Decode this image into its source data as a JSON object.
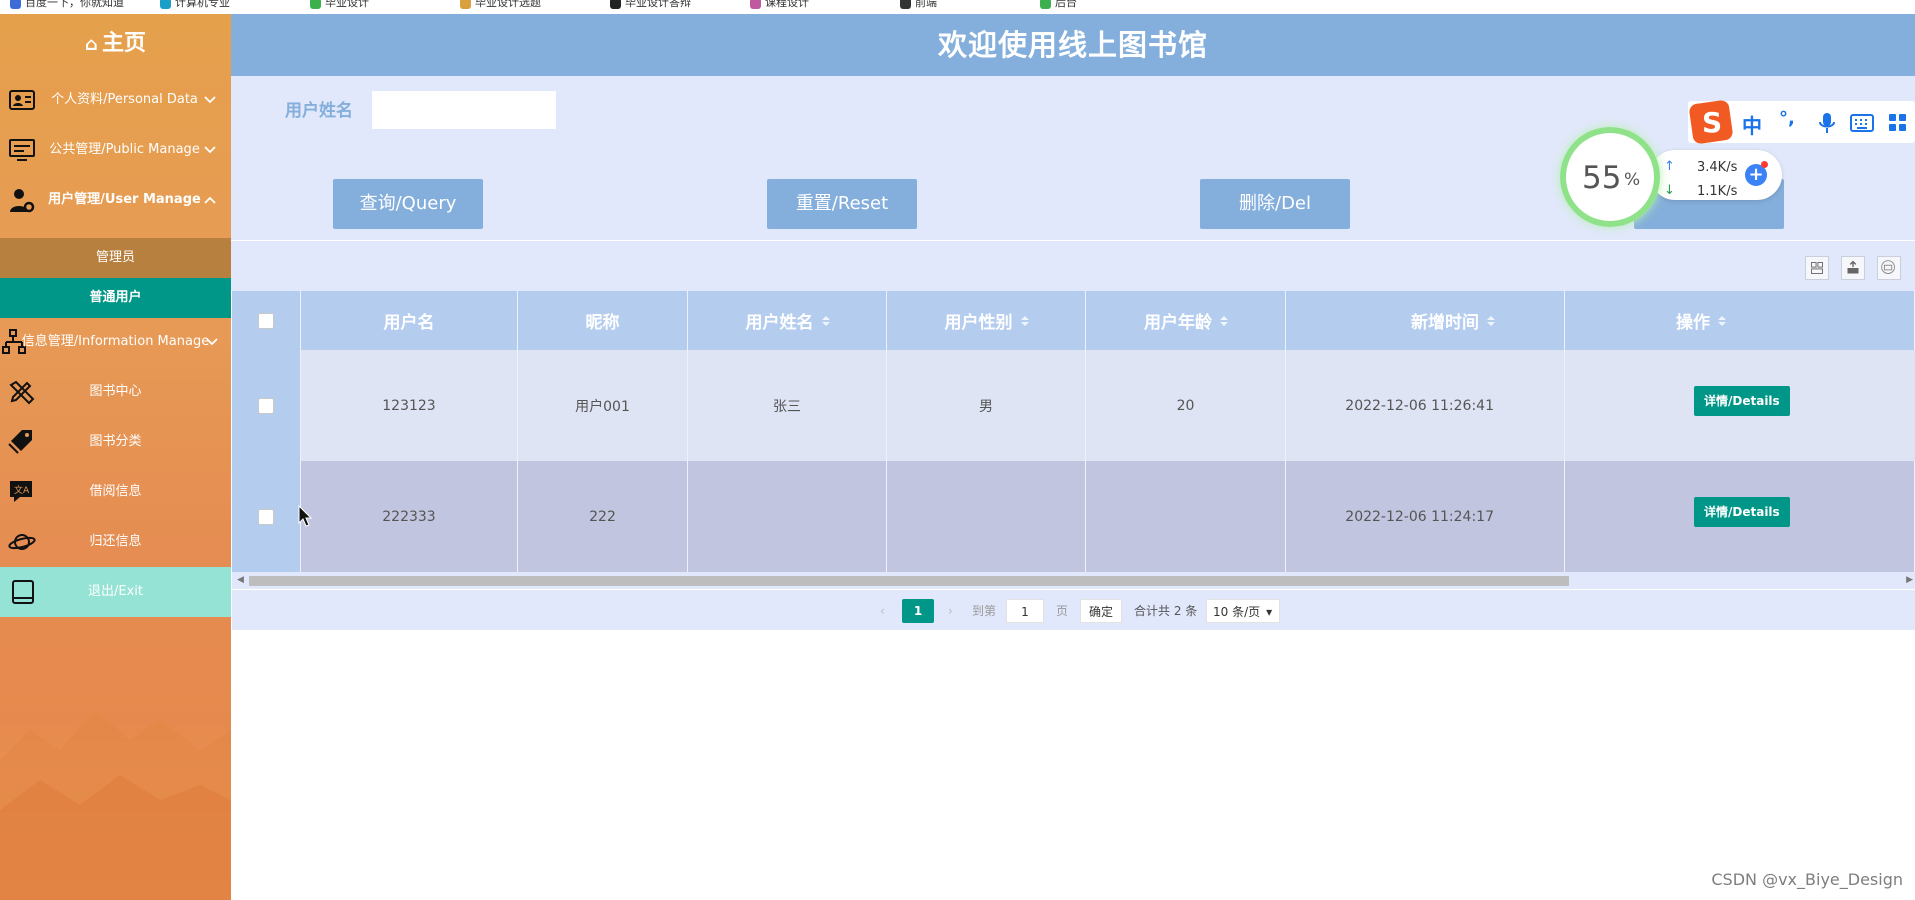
{
  "bookmarks": [
    "百度一下，你就知道",
    "计算机专业",
    "毕业设计",
    "毕业设计选题",
    "毕业设计答辩",
    "课程设计",
    "前端",
    "后台"
  ],
  "sidebar": {
    "home_label": "主页",
    "items": [
      {
        "label": "个人资料/Personal Data"
      },
      {
        "label": "公共管理/Public Manage"
      },
      {
        "label": "用户管理/User Manage"
      },
      {
        "label": "信息管理/Information Manage"
      },
      {
        "label": "图书中心"
      },
      {
        "label": "图书分类"
      },
      {
        "label": "借阅信息"
      },
      {
        "label": "归还信息"
      }
    ],
    "user_manage_sub": [
      "管理员",
      "普通用户"
    ],
    "exit_label": "退出/Exit"
  },
  "header": {
    "title": "欢迎使用线上图书馆"
  },
  "search": {
    "field_label": "用户姓名",
    "field_value": ""
  },
  "buttons": {
    "query": "查询/Query",
    "reset": "重置/Reset",
    "delete": "删除/Del"
  },
  "table": {
    "columns": [
      "用户名",
      "昵称",
      "用户姓名",
      "用户性别",
      "用户年龄",
      "新增时间",
      "操作"
    ],
    "rows": [
      {
        "username": "123123",
        "nickname": "用户001",
        "realname": "张三",
        "gender": "男",
        "age": "20",
        "created": "2022-12-06 11:26:41",
        "action": "详情/Details"
      },
      {
        "username": "222333",
        "nickname": "222",
        "realname": "",
        "gender": "",
        "age": "",
        "created": "2022-12-06 11:24:17",
        "action": "详情/Details"
      }
    ]
  },
  "pager": {
    "current_page": "1",
    "goto_prefix": "到第",
    "goto_value": "1",
    "goto_suffix": "页",
    "confirm": "确定",
    "total": "合计共 2 条",
    "page_size": "10 条/页"
  },
  "overlay": {
    "ime_label": "中",
    "ime_punct": "°,",
    "cpu_percent": "55",
    "cpu_unit": "%",
    "upload": "3.4K/s",
    "download": "1.1K/s"
  },
  "watermark": "CSDN @vx_Biye_Design",
  "colors": {
    "sidebar": "#e79a55",
    "header": "#84aedb",
    "teal": "#009688",
    "panel": "#e1e8fb"
  }
}
